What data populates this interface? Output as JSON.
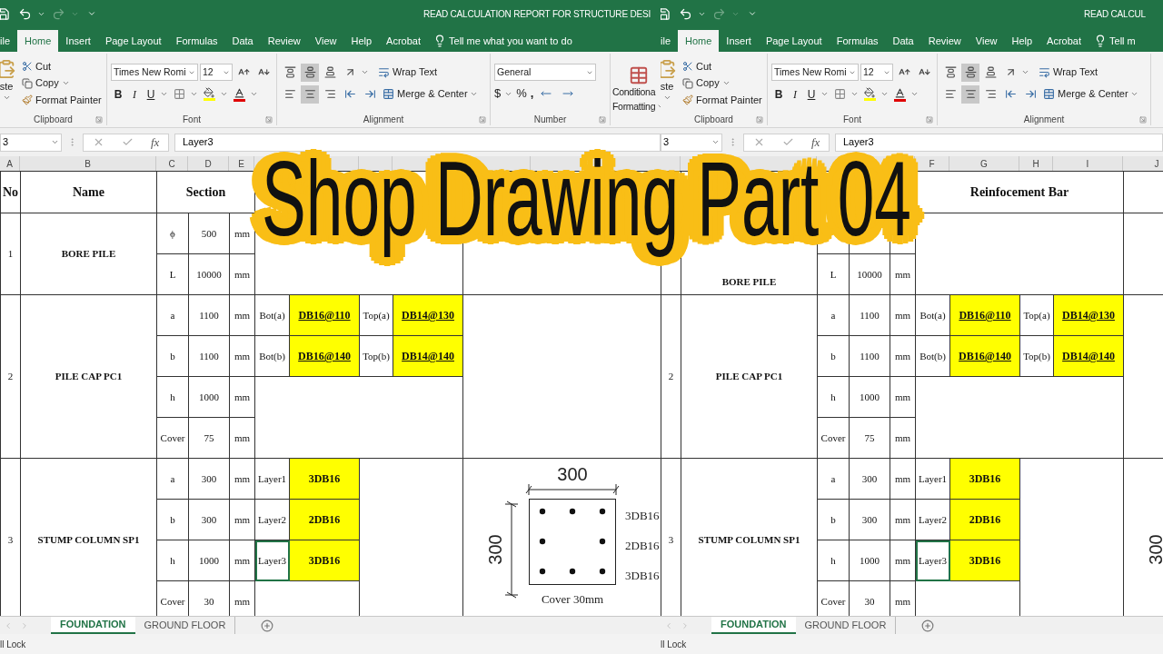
{
  "overlay_title": "Shop Drawing Part 04",
  "panes": [
    {
      "title": "READ CALCULATION REPORT FOR STRUCTURE DESI",
      "tabs": [
        {
          "label": "ile",
          "selected": false
        },
        {
          "label": "Home",
          "selected": true
        },
        {
          "label": "Insert",
          "selected": false
        },
        {
          "label": "Page Layout",
          "selected": false
        },
        {
          "label": "Formulas",
          "selected": false
        },
        {
          "label": "Data",
          "selected": false
        },
        {
          "label": "Review",
          "selected": false
        },
        {
          "label": "View",
          "selected": false
        },
        {
          "label": "Help",
          "selected": false
        },
        {
          "label": "Acrobat",
          "selected": false
        }
      ],
      "tell_me": "Tell me what you want to do",
      "clipboard": {
        "paste": "ste",
        "cut": "Cut",
        "copy": "Copy",
        "painter": "Format Painter",
        "label": "Clipboard"
      },
      "font": {
        "name": "Times New Romi",
        "size": "12",
        "bold": "B",
        "italic": "I",
        "underline": "U",
        "label": "Font"
      },
      "alignment": {
        "wrap": "Wrap Text",
        "merge": "Merge & Center",
        "label": "Alignment"
      },
      "number": {
        "format": "General",
        "currency": "$",
        "percent": "%",
        "comma": ",",
        "label": "Number"
      },
      "styles": {
        "line1": "Conditiona",
        "line2": "Formatting"
      },
      "name_box": "3",
      "fx": "fx",
      "formula": "Layer3",
      "column_headers": [
        "A",
        "B",
        "C",
        "D",
        "E"
      ],
      "header": {
        "no": "No",
        "name": "Name",
        "section": "Section"
      },
      "items": [
        {
          "kind": "pile",
          "no": "1",
          "name": "BORE PILE",
          "rows": [
            {
              "sym": "ϕ",
              "value": "500",
              "unit": "mm"
            },
            {
              "sym": "L",
              "value": "10000",
              "unit": "mm"
            }
          ]
        },
        {
          "kind": "cap",
          "no": "2",
          "name": "PILE CAP PC1",
          "rows": [
            {
              "sym": "a",
              "value": "1100",
              "unit": "mm",
              "bars": [
                {
                  "text": "Bot(a)",
                  "highlight": false
                },
                {
                  "text": "DB16@110",
                  "highlight": true
                },
                {
                  "text": "Top(a)",
                  "highlight": false
                },
                {
                  "text": "DB14@130",
                  "highlight": true
                }
              ]
            },
            {
              "sym": "b",
              "value": "1100",
              "unit": "mm",
              "bars": [
                {
                  "text": "Bot(b)",
                  "highlight": false
                },
                {
                  "text": "DB16@140",
                  "highlight": true
                },
                {
                  "text": "Top(b)",
                  "highlight": false
                },
                {
                  "text": "DB14@140",
                  "highlight": true
                }
              ]
            },
            {
              "sym": "h",
              "value": "1000",
              "unit": "mm"
            },
            {
              "sym": "Cover",
              "value": "75",
              "unit": "mm"
            }
          ]
        },
        {
          "kind": "column",
          "no": "3",
          "name": "STUMP COLUMN SP1",
          "rows": [
            {
              "sym": "a",
              "value": "300",
              "unit": "mm",
              "layer": {
                "text": "Layer1",
                "selected": false
              },
              "bars": "3DB16"
            },
            {
              "sym": "b",
              "value": "300",
              "unit": "mm",
              "layer": {
                "text": "Layer2",
                "selected": false
              },
              "bars": "2DB16"
            },
            {
              "sym": "h",
              "value": "1000",
              "unit": "mm",
              "layer": {
                "text": "Layer3",
                "selected": true
              },
              "bars": "3DB16"
            },
            {
              "sym": "Cover",
              "value": "30",
              "unit": "mm"
            }
          ]
        }
      ],
      "drawing": {
        "top_dim": "300",
        "side_dim": "300",
        "labels": [
          "3DB16",
          "2DB16",
          "3DB16"
        ],
        "cover": "Cover 30mm"
      },
      "sheets": [
        {
          "label": "FOUNDATION",
          "selected": true
        },
        {
          "label": "GROUND FLOOR",
          "selected": false
        }
      ],
      "status": "ll Lock"
    },
    {
      "title": "READ CALCUL",
      "tabs": [
        {
          "label": "ile",
          "selected": false
        },
        {
          "label": "Home",
          "selected": true
        },
        {
          "label": "Insert",
          "selected": false
        },
        {
          "label": "Page Layout",
          "selected": false
        },
        {
          "label": "Formulas",
          "selected": false
        },
        {
          "label": "Data",
          "selected": false
        },
        {
          "label": "Review",
          "selected": false
        },
        {
          "label": "View",
          "selected": false
        },
        {
          "label": "Help",
          "selected": false
        },
        {
          "label": "Acrobat",
          "selected": false
        }
      ],
      "tell_me": "Tell m",
      "clipboard": {
        "paste": "ste",
        "cut": "Cut",
        "copy": "Copy",
        "painter": "Format Painter",
        "label": "Clipboard"
      },
      "font": {
        "name": "Times New Romi",
        "size": "12",
        "bold": "B",
        "italic": "I",
        "underline": "U",
        "label": "Font"
      },
      "alignment": {
        "wrap": "Wrap Text",
        "merge": "Merge & Center",
        "label": "Alignment"
      },
      "name_box": "3",
      "fx": "fx",
      "formula": "Layer3",
      "column_headers": [
        "F",
        "G",
        "H",
        "I",
        "J"
      ],
      "header": {
        "reinforcement": "Reinfocement Bar"
      },
      "items": [
        {
          "kind": "pile",
          "name": "BORE PILE",
          "rows": [
            {},
            {
              "sym": "L",
              "value": "10000",
              "unit": "mm"
            }
          ]
        },
        {
          "kind": "cap",
          "no": "2",
          "name": "PILE CAP PC1",
          "rows": [
            {
              "sym": "a",
              "value": "1100",
              "unit": "mm",
              "bars": [
                {
                  "text": "Bot(a)",
                  "highlight": false
                },
                {
                  "text": "DB16@110",
                  "highlight": true
                },
                {
                  "text": "Top(a)",
                  "highlight": false
                },
                {
                  "text": "DB14@130",
                  "highlight": true
                }
              ]
            },
            {
              "sym": "b",
              "value": "1100",
              "unit": "mm",
              "bars": [
                {
                  "text": "Bot(b)",
                  "highlight": false
                },
                {
                  "text": "DB16@140",
                  "highlight": true
                },
                {
                  "text": "Top(b)",
                  "highlight": false
                },
                {
                  "text": "DB14@140",
                  "highlight": true
                }
              ]
            },
            {
              "sym": "h",
              "value": "1000",
              "unit": "mm"
            },
            {
              "sym": "Cover",
              "value": "75",
              "unit": "mm"
            }
          ]
        },
        {
          "kind": "column",
          "no": "3",
          "name": "STUMP COLUMN SP1",
          "rows": [
            {
              "sym": "a",
              "value": "300",
              "unit": "mm",
              "layer": {
                "text": "Layer1",
                "selected": false
              },
              "bars": "3DB16"
            },
            {
              "sym": "b",
              "value": "300",
              "unit": "mm",
              "layer": {
                "text": "Layer2",
                "selected": false
              },
              "bars": "2DB16"
            },
            {
              "sym": "h",
              "value": "1000",
              "unit": "mm",
              "layer": {
                "text": "Layer3",
                "selected": true
              },
              "bars": "3DB16"
            },
            {
              "sym": "Cover",
              "value": "30",
              "unit": "mm"
            }
          ]
        }
      ],
      "drawing": {
        "side_dim": "300"
      },
      "sheets": [
        {
          "label": "FOUNDATION",
          "selected": true
        },
        {
          "label": "GROUND FLOOR",
          "selected": false
        }
      ],
      "status": "ll Lock"
    }
  ]
}
